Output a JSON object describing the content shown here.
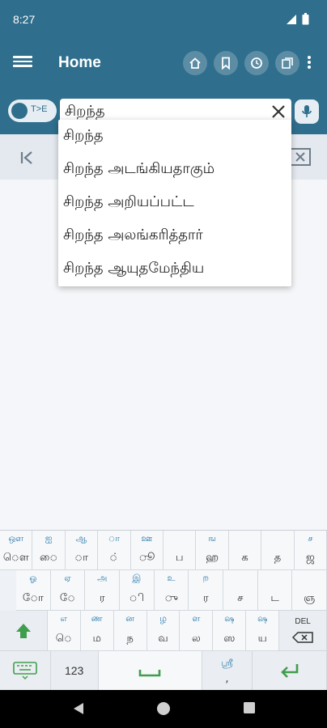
{
  "status": {
    "time": "8:27"
  },
  "header": {
    "title": "Home",
    "color": "#2f6e8c",
    "actions": [
      "home-icon",
      "bookmark-icon",
      "history-icon",
      "library-icon"
    ]
  },
  "search": {
    "toggle_label": "T>E",
    "value": "சிறந்த"
  },
  "suggestions": [
    "சிறந்த",
    "சிறந்த அடங்கியதாகும்",
    "சிறந்த அறியப்பட்ட",
    "சிறந்த அலங்கரித்தார்",
    "சிறந்த ஆயுதமேந்திய"
  ],
  "keyboard": {
    "row1": [
      {
        "hint": "ஔ",
        "main": "ௌ"
      },
      {
        "hint": "ஐ",
        "main": "ை"
      },
      {
        "hint": "ஆ",
        "main": "ா"
      },
      {
        "hint": "ா",
        "main": "்"
      },
      {
        "hint": "ஊ",
        "main": "ூ"
      },
      {
        "hint": "",
        "main": "ப"
      },
      {
        "hint": "ங",
        "main": "ஹ"
      },
      {
        "hint": "",
        "main": "க"
      },
      {
        "hint": "",
        "main": "த"
      },
      {
        "hint": "ச",
        "main": "ஜ"
      }
    ],
    "row2": [
      {
        "hint": "ஓ",
        "main": "ோ"
      },
      {
        "hint": "ஏ",
        "main": "ே"
      },
      {
        "hint": "அ",
        "main": "ர"
      },
      {
        "hint": "இ",
        "main": "ி"
      },
      {
        "hint": "உ",
        "main": "ு"
      },
      {
        "hint": "ற",
        "main": "ர"
      },
      {
        "hint": "",
        "main": "ச"
      },
      {
        "hint": "",
        "main": "ட"
      },
      {
        "hint": "",
        "main": "ஞ"
      }
    ],
    "row3": [
      {
        "hint": "எ",
        "main": "ெ"
      },
      {
        "hint": "ண",
        "main": "ம"
      },
      {
        "hint": "ன",
        "main": "ந"
      },
      {
        "hint": "ழ",
        "main": "வ"
      },
      {
        "hint": "ள",
        "main": "ல"
      },
      {
        "hint": "ஷ",
        "main": "ஸ"
      },
      {
        "hint": "ஷ",
        "main": "ய"
      }
    ],
    "del_label": "DEL",
    "num_label": "123",
    "sri_label": "ஸ்ரீ",
    "sri_sub": ","
  }
}
